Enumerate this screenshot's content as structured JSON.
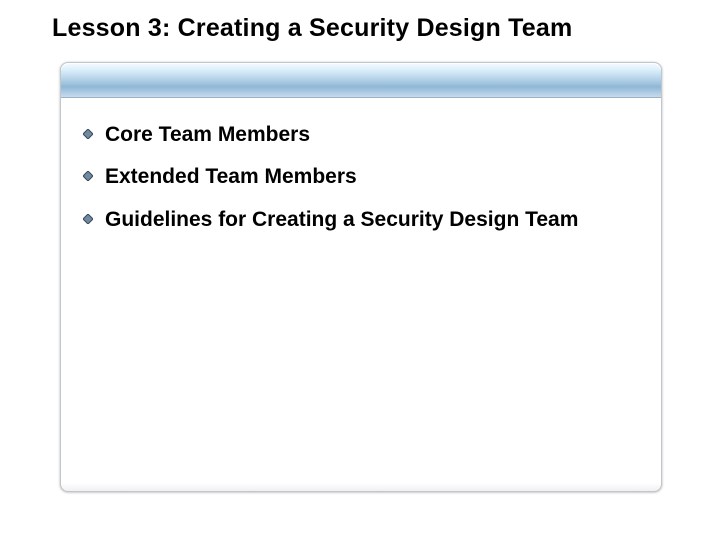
{
  "title": "Lesson 3: Creating a Security Design Team",
  "bullets": [
    "Core Team Members",
    "Extended Team Members",
    "Guidelines for Creating a Security Design Team"
  ],
  "colors": {
    "bullet_fill": "#6f8aa3",
    "bullet_stroke": "#3a4957",
    "header_gradient_top": "#f5fbff",
    "header_gradient_mid": "#aecde4",
    "header_gradient_bottom": "#c7dced"
  }
}
